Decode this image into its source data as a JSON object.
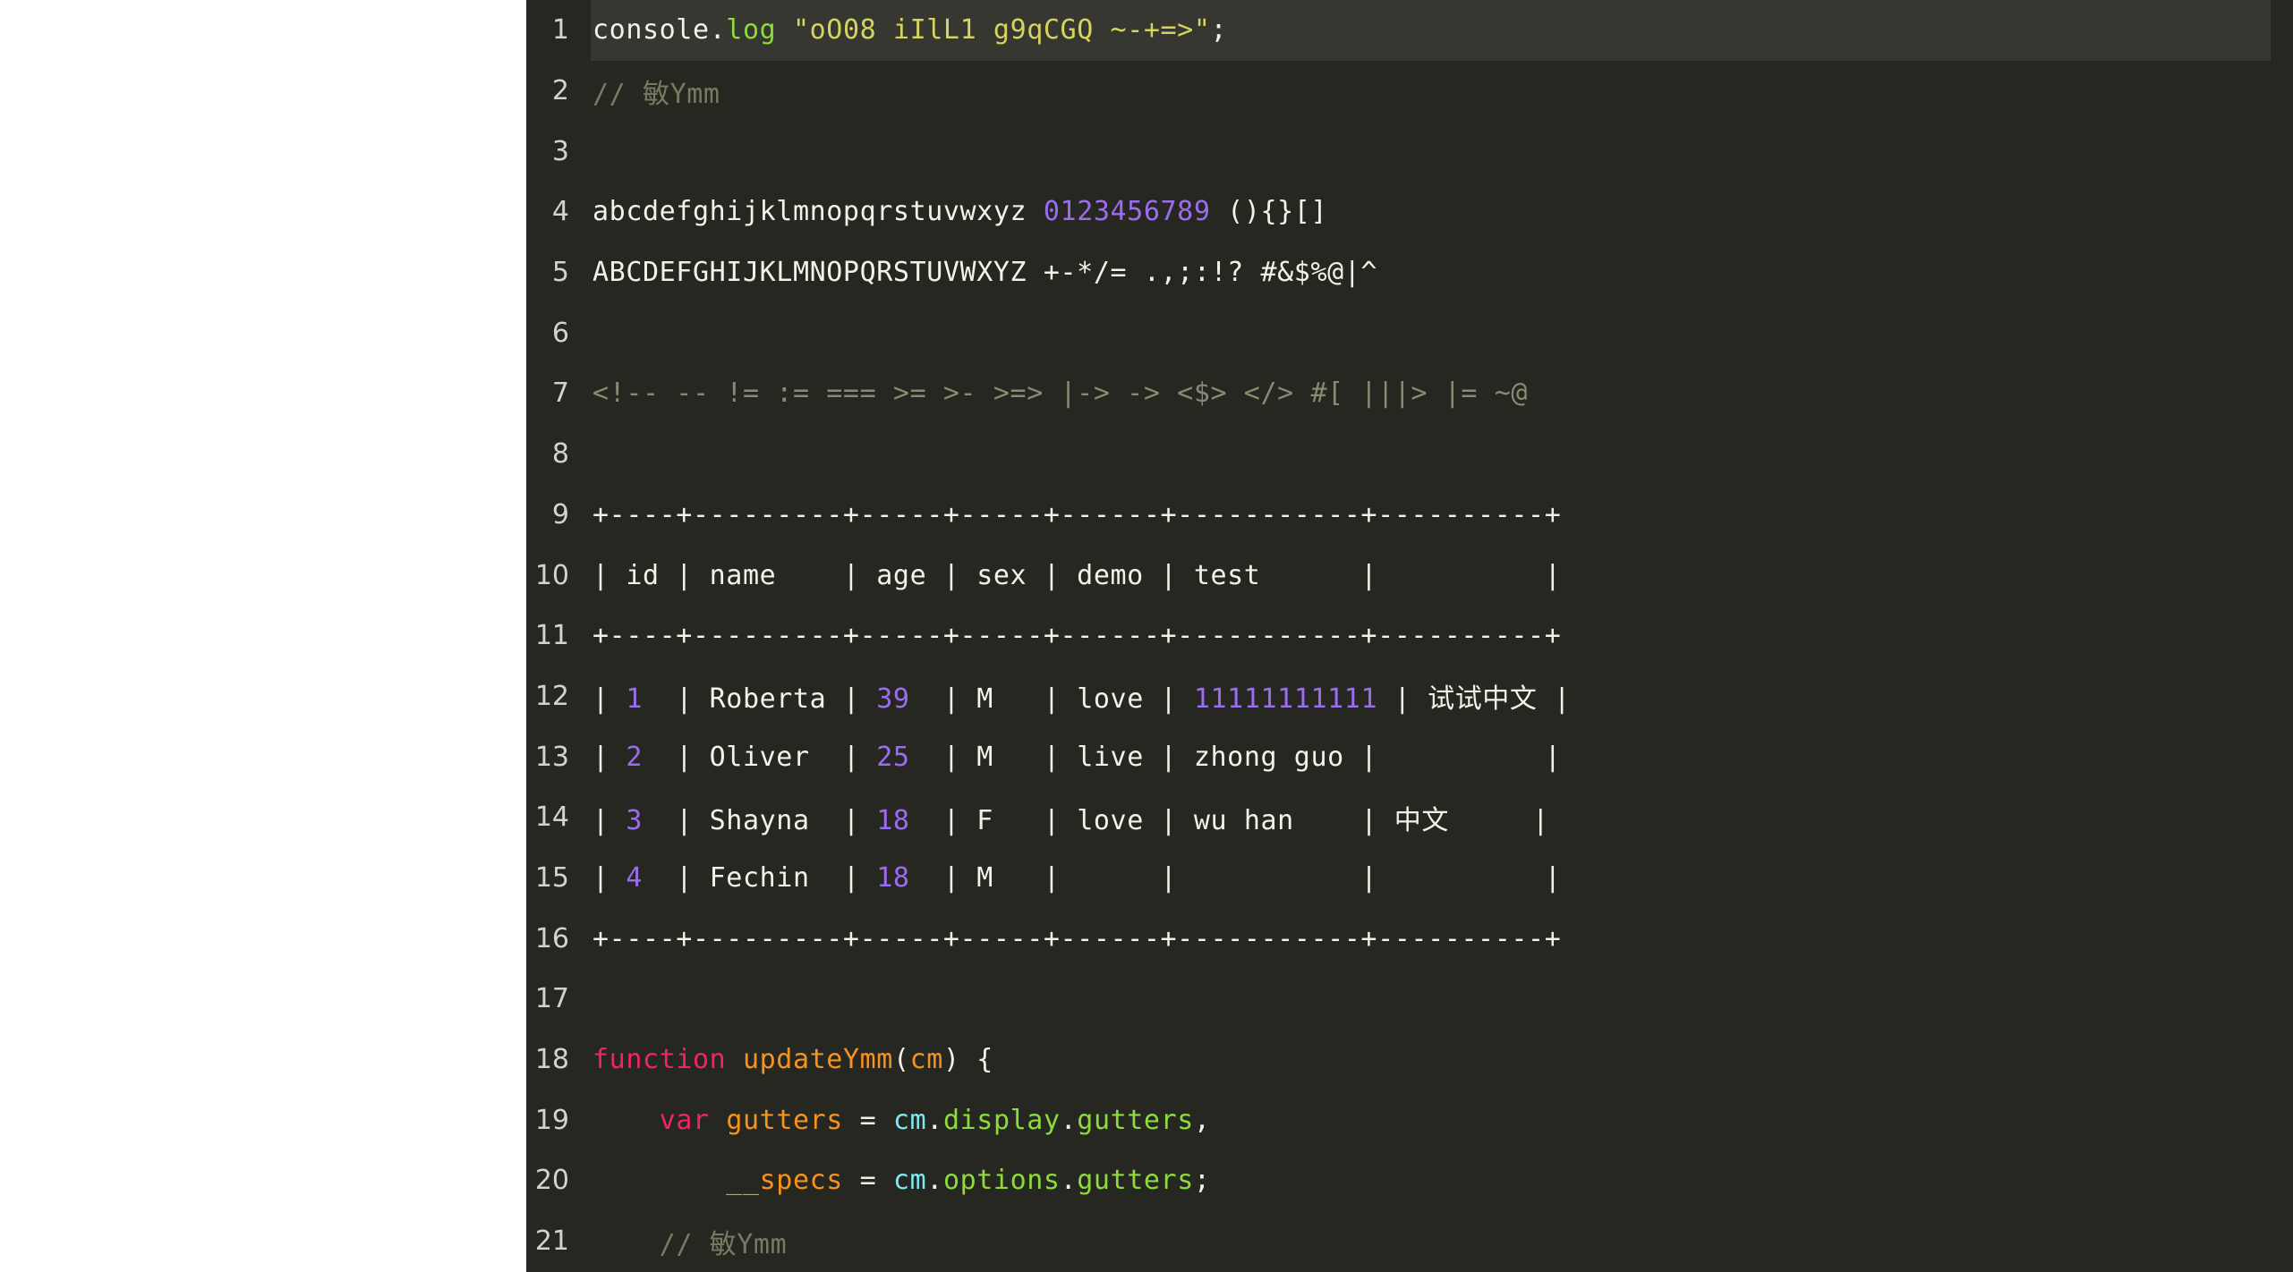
{
  "editor": {
    "theme_name": "dark-olive",
    "background": "#262720",
    "active_line_background": "#353730",
    "gutter_text_color": "#d3d3cc",
    "default_text_color": "#f2f2e8",
    "active_line": 1,
    "first_visible_line": 1,
    "last_visible_line": 21
  },
  "colors": {
    "keyword": "#f2226b",
    "variable": "#f7921e",
    "property": "#8ddb3c",
    "string": "#d6d35e",
    "number": "#9a6df0",
    "comment": "#7a7a63",
    "operator": "#8a8a72",
    "atom": "#7fe8f5",
    "plain": "#f2f2e8"
  },
  "lines": [
    {
      "number": "1",
      "active": true,
      "tokens": [
        {
          "text": "console.",
          "type": "plain"
        },
        {
          "text": "log",
          "type": "property"
        },
        {
          "text": " ",
          "type": "plain"
        },
        {
          "text": "\"oO08 iIlL1 g9qCGQ ~-+=>\"",
          "type": "string"
        },
        {
          "text": ";",
          "type": "plain"
        }
      ]
    },
    {
      "number": "2",
      "active": false,
      "tokens": [
        {
          "text": "// 敏Ymm",
          "type": "comment"
        }
      ]
    },
    {
      "number": "3",
      "active": false,
      "tokens": []
    },
    {
      "number": "4",
      "active": false,
      "tokens": [
        {
          "text": "abcdefghijklmnopqrstuvwxyz ",
          "type": "plain"
        },
        {
          "text": "0123456789",
          "type": "number"
        },
        {
          "text": " (){}[]",
          "type": "plain"
        }
      ]
    },
    {
      "number": "5",
      "active": false,
      "tokens": [
        {
          "text": "ABCDEFGHIJKLMNOPQRSTUVWXYZ +-*/= .,;:!? #&$%@|^",
          "type": "plain"
        }
      ]
    },
    {
      "number": "6",
      "active": false,
      "tokens": []
    },
    {
      "number": "7",
      "active": false,
      "tokens": [
        {
          "text": "<!-- -- != := === >= >- >=> |-> -> <$> </> #[ |||> |= ~@",
          "type": "operator"
        }
      ]
    },
    {
      "number": "8",
      "active": false,
      "tokens": []
    },
    {
      "number": "9",
      "active": false,
      "tokens": [
        {
          "text": "+----+---------+-----+-----+------+-----------+----------+",
          "type": "plain"
        }
      ]
    },
    {
      "number": "10",
      "active": false,
      "tokens": [
        {
          "text": "| id | name    | age | sex | demo | test      |          |",
          "type": "plain"
        }
      ]
    },
    {
      "number": "11",
      "active": false,
      "tokens": [
        {
          "text": "+----+---------+-----+-----+------+-----------+----------+",
          "type": "plain"
        }
      ]
    },
    {
      "number": "12",
      "active": false,
      "tokens": [
        {
          "text": "| ",
          "type": "plain"
        },
        {
          "text": "1",
          "type": "number"
        },
        {
          "text": "  | Roberta | ",
          "type": "plain"
        },
        {
          "text": "39",
          "type": "number"
        },
        {
          "text": "  | M   | love | ",
          "type": "plain"
        },
        {
          "text": "11111111111",
          "type": "number"
        },
        {
          "text": " | 试试中文 |",
          "type": "plain"
        }
      ]
    },
    {
      "number": "13",
      "active": false,
      "tokens": [
        {
          "text": "| ",
          "type": "plain"
        },
        {
          "text": "2",
          "type": "number"
        },
        {
          "text": "  | Oliver  | ",
          "type": "plain"
        },
        {
          "text": "25",
          "type": "number"
        },
        {
          "text": "  | M   | live | zhong guo |          |",
          "type": "plain"
        }
      ]
    },
    {
      "number": "14",
      "active": false,
      "tokens": [
        {
          "text": "| ",
          "type": "plain"
        },
        {
          "text": "3",
          "type": "number"
        },
        {
          "text": "  | Shayna  | ",
          "type": "plain"
        },
        {
          "text": "18",
          "type": "number"
        },
        {
          "text": "  | F   | love | wu han    | 中文     |",
          "type": "plain"
        }
      ]
    },
    {
      "number": "15",
      "active": false,
      "tokens": [
        {
          "text": "| ",
          "type": "plain"
        },
        {
          "text": "4",
          "type": "number"
        },
        {
          "text": "  | Fechin  | ",
          "type": "plain"
        },
        {
          "text": "18",
          "type": "number"
        },
        {
          "text": "  | M   |      |           |          |",
          "type": "plain"
        }
      ]
    },
    {
      "number": "16",
      "active": false,
      "tokens": [
        {
          "text": "+----+---------+-----+-----+------+-----------+----------+",
          "type": "plain"
        }
      ]
    },
    {
      "number": "17",
      "active": false,
      "tokens": []
    },
    {
      "number": "18",
      "active": false,
      "tokens": [
        {
          "text": "function",
          "type": "keyword"
        },
        {
          "text": " ",
          "type": "plain"
        },
        {
          "text": "updateYmm",
          "type": "variable"
        },
        {
          "text": "(",
          "type": "plain"
        },
        {
          "text": "cm",
          "type": "variable"
        },
        {
          "text": ") {",
          "type": "plain"
        }
      ]
    },
    {
      "number": "19",
      "active": false,
      "tokens": [
        {
          "text": "    ",
          "type": "plain"
        },
        {
          "text": "var",
          "type": "keyword"
        },
        {
          "text": " ",
          "type": "plain"
        },
        {
          "text": "gutters",
          "type": "variable"
        },
        {
          "text": " = ",
          "type": "plain"
        },
        {
          "text": "cm",
          "type": "atom"
        },
        {
          "text": ".",
          "type": "plain"
        },
        {
          "text": "display",
          "type": "property"
        },
        {
          "text": ".",
          "type": "plain"
        },
        {
          "text": "gutters",
          "type": "property"
        },
        {
          "text": ",",
          "type": "plain"
        }
      ]
    },
    {
      "number": "20",
      "active": false,
      "tokens": [
        {
          "text": "        ",
          "type": "plain"
        },
        {
          "text": "__specs",
          "type": "variable"
        },
        {
          "text": " = ",
          "type": "plain"
        },
        {
          "text": "cm",
          "type": "atom"
        },
        {
          "text": ".",
          "type": "plain"
        },
        {
          "text": "options",
          "type": "property"
        },
        {
          "text": ".",
          "type": "plain"
        },
        {
          "text": "gutters",
          "type": "property"
        },
        {
          "text": ";",
          "type": "plain"
        }
      ]
    },
    {
      "number": "21",
      "active": false,
      "tokens": [
        {
          "text": "    ",
          "type": "plain"
        },
        {
          "text": "// 敏Ymm",
          "type": "comment"
        }
      ]
    }
  ]
}
